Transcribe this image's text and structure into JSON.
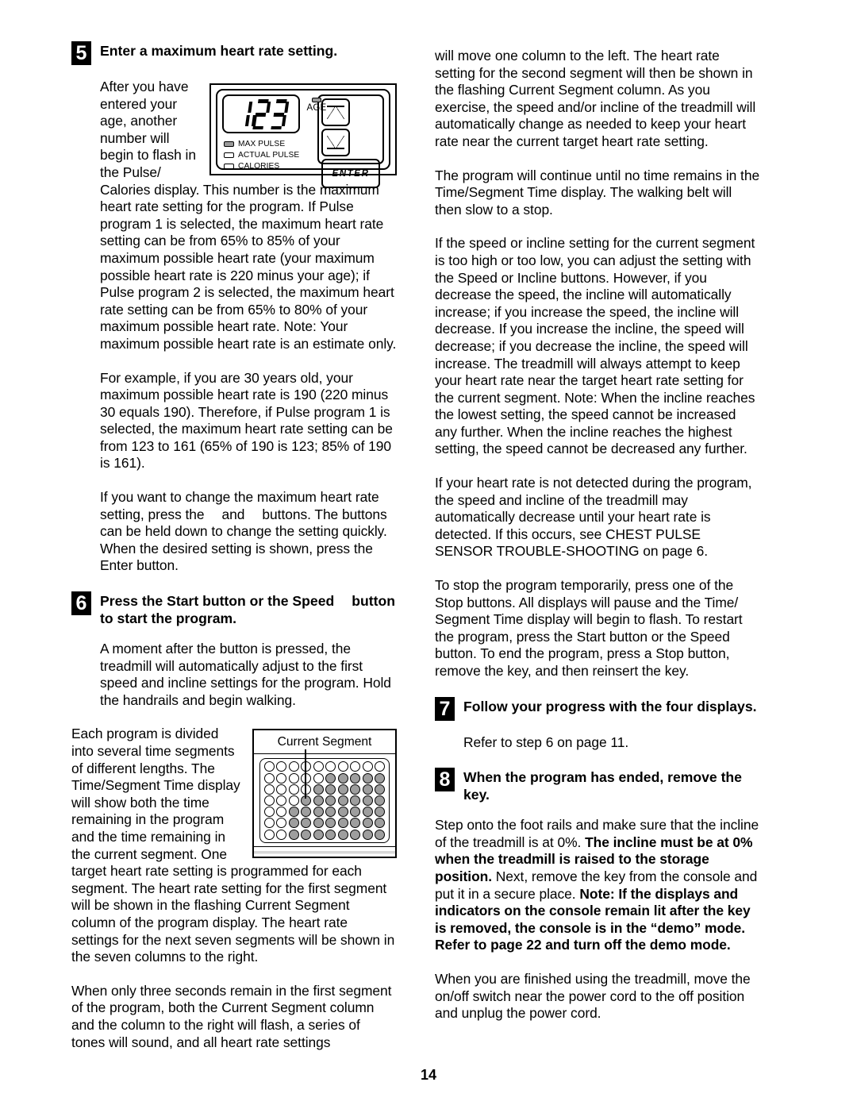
{
  "page_number": "14",
  "left_column": {
    "step5": {
      "number": "5",
      "title": "Enter a maximum heart rate setting.",
      "paragraph_1": "After you have entered your age, another number will begin to flash in the Pulse/ Calories display. This number is the maximum heart rate setting for the program. If Pulse program 1 is selected, the maximum heart rate setting can be from 65% to 85% of your maximum possible heart rate (your maximum possible heart rate is 220 minus your age); if Pulse program 2 is selected, the maximum heart rate setting can be from 65% to 80% of your maximum possible heart rate. Note: Your maximum possible heart rate is an estimate only.",
      "paragraph_2": "For example, if you are 30 years old, your maximum possible heart rate is 190 (220 minus 30 equals 190). Therefore, if Pulse program 1 is selected, the maximum heart rate setting can be from 123 to 161 (65% of 190 is 123; 85% of 190 is 161).",
      "paragraph_3_part_1": "If you want to change the maximum heart rate setting, press the",
      "paragraph_3_part_2": "and",
      "paragraph_3_part_3": "buttons. The buttons can be held down to change the setting quickly. When the desired setting is shown, press the Enter button."
    },
    "console_figure": {
      "display_value": "123",
      "age_label": "AGE",
      "indicators": [
        {
          "label": "MAX PULSE",
          "lit": true
        },
        {
          "label": "ACTUAL PULSE",
          "lit": false
        },
        {
          "label": "CALORIES",
          "lit": false
        }
      ],
      "down_button": "down-arrow",
      "up_button": "up-arrow",
      "enter_button": "ENTER"
    },
    "step6": {
      "number": "6",
      "title_part_1": "Press the Start button or the Speed",
      "title_part_2": "button to start the program.",
      "paragraph_1": "A moment after the button is pressed, the treadmill will automatically adjust to the first speed and incline settings for the program. Hold the handrails and begin walking.",
      "paragraph_2": "Each program is divided into several time segments of different lengths. The Time/Segment Time display will show both the time remaining in the program and the time remaining in the current segment. One target heart rate setting is programmed for each segment. The heart rate setting for the first segment will be shown in the flashing Current Segment column of the program display. The heart rate settings for the next seven segments will be shown in the seven columns to the right.",
      "paragraph_3": "When only three seconds remain in the first segment of the program, both the Current Segment column and the column to the right will flash, a series of tones will sound, and all heart rate settings"
    },
    "segment_figure": {
      "title": "Current Segment",
      "rows": 7,
      "columns": 10,
      "grid": [
        [
          0,
          0,
          0,
          0,
          0,
          0,
          0,
          0,
          0,
          0
        ],
        [
          0,
          0,
          0,
          0,
          0,
          1,
          1,
          1,
          1,
          1
        ],
        [
          0,
          0,
          0,
          0,
          1,
          1,
          1,
          1,
          1,
          1
        ],
        [
          0,
          0,
          0,
          1,
          1,
          1,
          1,
          1,
          1,
          1
        ],
        [
          0,
          0,
          1,
          1,
          1,
          1,
          1,
          1,
          1,
          1
        ],
        [
          0,
          0,
          1,
          1,
          1,
          1,
          1,
          1,
          1,
          1
        ],
        [
          0,
          0,
          1,
          1,
          1,
          1,
          1,
          1,
          1,
          1
        ]
      ]
    }
  },
  "right_column": {
    "paragraph_1": "will move one column to the left. The heart rate setting for the second segment will then be shown in the flashing Current Segment column. As you exercise, the speed and/or incline of the treadmill will automatically change as needed to keep your heart rate near the current target heart rate setting.",
    "paragraph_2": "The program will continue until no time remains in the Time/Segment Time display. The walking belt will then slow to a stop.",
    "paragraph_3": "If the speed or incline setting for the current segment is too high or too low, you can adjust the setting with the Speed or Incline buttons. However, if you decrease the speed, the incline will automatically increase; if you increase the speed, the incline will decrease. If you increase the incline, the speed will decrease; if you decrease the incline, the speed will increase. The treadmill will always attempt to keep your heart rate near the target heart rate setting for the current segment. Note: When the incline reaches the lowest setting, the speed cannot be increased any further. When the incline reaches the highest setting, the speed cannot be decreased any further.",
    "paragraph_4": "If your heart rate is not detected during the program, the speed and incline of the treadmill may automatically decrease until your heart rate is detected. If this occurs, see CHEST PULSE SENSOR TROUBLE-SHOOTING on page 6.",
    "paragraph_5_part_1": "To stop the program temporarily, press one of the Stop buttons. All displays will pause and the Time/ Segment Time display will begin to flash. To restart the program, press the Start button or the Speed",
    "paragraph_5_part_2": "button. To end the program, press a Stop button, remove the key, and then reinsert the key.",
    "step7": {
      "number": "7",
      "title": "Follow your progress with the four displays.",
      "paragraph_1": "Refer to step 6 on page 11."
    },
    "step8": {
      "number": "8",
      "title": "When the program has ended, remove the key.",
      "paragraph_1_normal_1": "Step onto the foot rails and make sure that the incline of the treadmill is at 0%. ",
      "paragraph_1_bold_1": "The incline must be at 0% when the treadmill is raised to the storage position.",
      "paragraph_1_normal_2": " Next, remove the key from the console and put it in a secure place. ",
      "paragraph_1_bold_2": "Note: If the displays and indicators on the console remain lit after the key is removed, the console is in the “demo” mode. Refer to page 22 and turn off the demo mode.",
      "paragraph_2": "When you are finished using the treadmill, move the on/off switch near the power cord to the off position and unplug the power cord."
    }
  }
}
